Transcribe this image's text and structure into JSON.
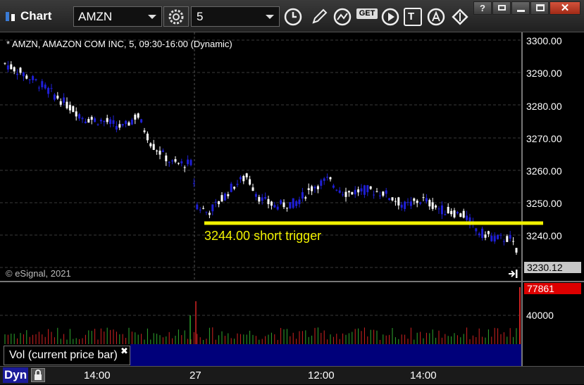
{
  "window": {
    "title": "Chart"
  },
  "toolbar": {
    "symbol": "AMZN",
    "interval": "5",
    "get_label": "GET",
    "text_label": "T"
  },
  "chart": {
    "title": "* AMZN, AMAZON COM INC, 5, 09:30-16:00 (Dynamic)",
    "copyright": "© eSignal, 2021",
    "annotation": "3244.00 short trigger",
    "y_axis": [
      "3300.00",
      "3290.00",
      "3280.00",
      "3270.00",
      "3260.00",
      "3250.00",
      "3240.00"
    ],
    "last_price": "3230.12",
    "volume_axis": [
      "40000"
    ],
    "last_volume": "77861",
    "volume_label": "Vol (current price bar)",
    "x_axis": [
      "14:00",
      "27",
      "12:00",
      "14:00"
    ],
    "dyn_label": "Dyn",
    "colors": {
      "up": "#ffffff",
      "down": "#1f1fd6",
      "trigger": "#f2f200",
      "volume_up": "#2fa82f",
      "volume_down": "#d22222"
    }
  }
}
